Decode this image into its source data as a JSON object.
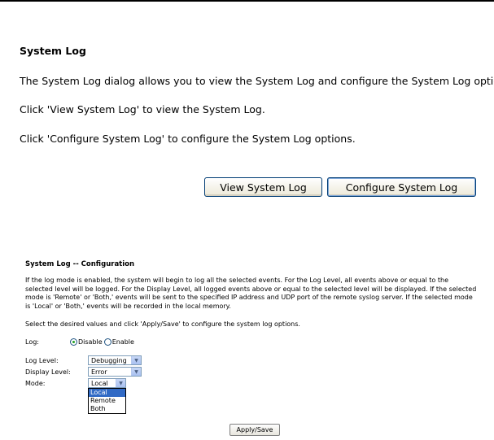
{
  "main": {
    "title": "System Log",
    "description": "The System Log dialog allows you to view the System Log and configure the System Log options.",
    "view_hint": "Click 'View System Log' to view the System Log.",
    "configure_hint": "Click 'Configure System Log' to configure the System Log options.",
    "view_button": "View System Log",
    "configure_button": "Configure System Log"
  },
  "config": {
    "title": "System Log -- Configuration",
    "description": "If the log mode is enabled, the system will begin to log all the selected events. For the Log Level, all events above or equal to the selected level will be logged. For the Display Level, all logged events above or equal to the selected level will be displayed. If the selected mode is 'Remote' or 'Both,' events will be sent to the specified IP address and UDP port of the remote syslog server. If the selected mode is 'Local' or 'Both,' events will be recorded in the local memory.",
    "instruction": "Select the desired values and click 'Apply/Save' to configure the system log options.",
    "log_label": "Log:",
    "log_options": [
      "Disable",
      "Enable"
    ],
    "log_selected": "Disable",
    "log_level_label": "Log Level:",
    "log_level_value": "Debugging",
    "display_level_label": "Display Level:",
    "display_level_value": "Error",
    "mode_label": "Mode:",
    "mode_value": "Local",
    "mode_options": [
      "Local",
      "Remote",
      "Both"
    ],
    "apply_button": "Apply/Save"
  },
  "icons": {
    "select_arrow": "chevron-down-icon"
  }
}
